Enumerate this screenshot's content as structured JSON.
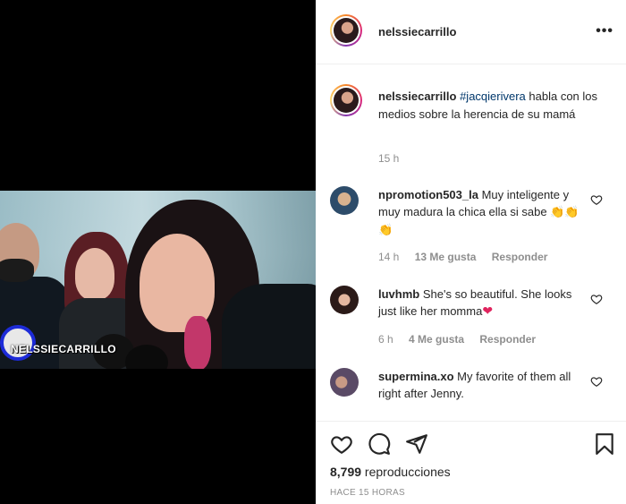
{
  "video": {
    "watermark": "NELSSIECARRILLO"
  },
  "header": {
    "username": "nelssiecarrillo",
    "more": "•••"
  },
  "caption": {
    "username": "nelssiecarrillo",
    "hashtag": "#jacqierivera",
    "text": " habla con los medios sobre la herencia de su mamá",
    "time": "15 h"
  },
  "comments": [
    {
      "username": "npromotion503_la",
      "text": " Muy inteligente y muy madura la chica ella si sabe ",
      "emoji": "👏👏👏",
      "time": "14 h",
      "likes": "13 Me gusta",
      "reply": "Responder"
    },
    {
      "username": "luvhmb",
      "text": " She's so beautiful. She looks just like her momma",
      "emoji": "❤",
      "time": "6 h",
      "likes": "4 Me gusta",
      "reply": "Responder"
    },
    {
      "username": "supermina.xo",
      "text": " My favorite of them all right after Jenny."
    }
  ],
  "actions": {
    "views_count": "8,799",
    "views_label": " reproducciones",
    "ago": "HACE 15 HORAS",
    "icons": [
      "heart-icon",
      "comment-icon",
      "share-icon",
      "bookmark-icon"
    ]
  },
  "colors": {
    "link": "#00376b",
    "muted": "#8e8e8e",
    "text": "#262626",
    "heart": "#e0245e"
  }
}
